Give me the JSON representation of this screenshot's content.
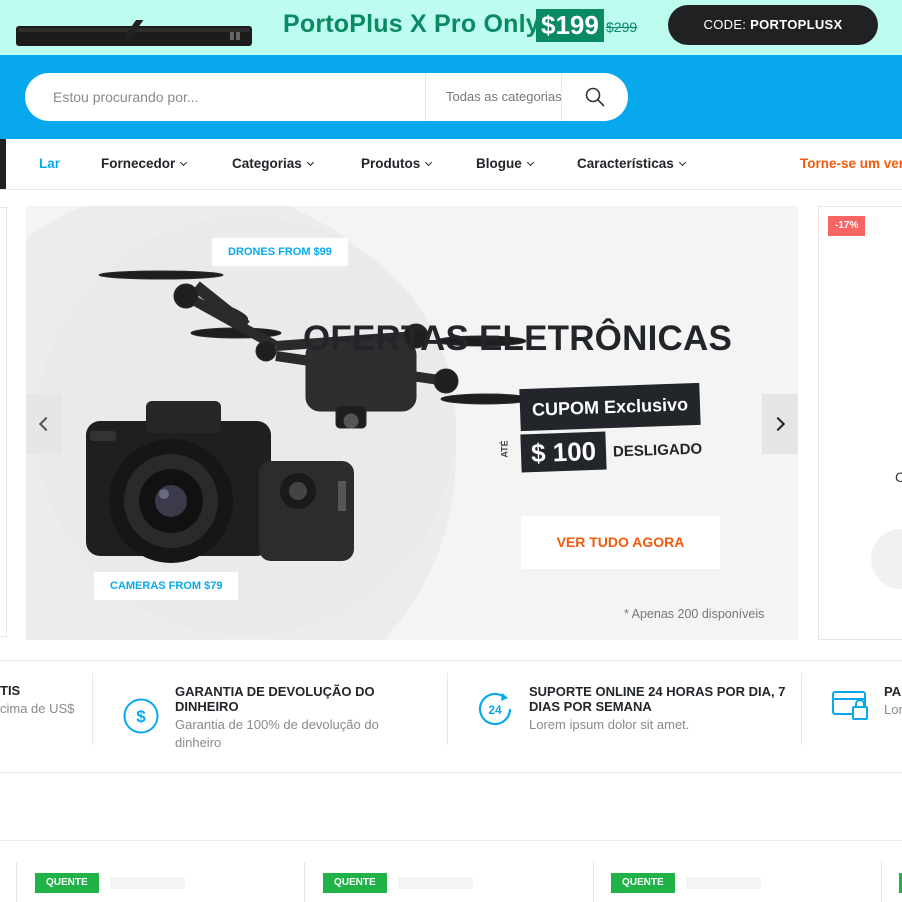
{
  "promo": {
    "headline": "PortoPlus X Pro Only",
    "price": "$199",
    "old_price": "$299",
    "code_prefix": "CODE:",
    "code_value": "PORTOPLUSX"
  },
  "search": {
    "placeholder": "Estou procurando por...",
    "category": "Todas as categorias",
    "icon": "search-icon"
  },
  "nav": {
    "items": [
      {
        "label": "Lar",
        "active": true
      },
      {
        "label": "Fornecedor"
      },
      {
        "label": "Categorias"
      },
      {
        "label": "Produtos"
      },
      {
        "label": "Blogue"
      },
      {
        "label": "Características"
      }
    ],
    "vendor_link": "Torne-se um vendedor"
  },
  "hero": {
    "tag_drones": "DRONES FROM $99",
    "tag_cameras": "CAMERAS FROM $79",
    "title": "OFERTAS ELETRÔNICAS",
    "coupon": "CUPOM Exclusivo",
    "ate": "ATÉ",
    "amount": "$ 100",
    "off": "DESLIGADO",
    "cta": "VER TUDO AGORA",
    "note": "* Apenas 200 disponíveis"
  },
  "side_product": {
    "discount": "-17%",
    "char": "C"
  },
  "features": [
    {
      "title": "TIS",
      "desc": "cima de US$",
      "icon": "truck-icon"
    },
    {
      "title": "GARANTIA DE DEVOLUÇÃO DO DINHEIRO",
      "desc": "Garantia de 100% de devolução do dinheiro",
      "icon": "dollar-icon"
    },
    {
      "title": "SUPORTE ONLINE 24 HORAS POR DIA, 7 DIAS POR SEMANA",
      "desc": "Lorem ipsum dolor sit amet.",
      "icon": "support-24-icon"
    },
    {
      "title": "PA",
      "desc": "Lor",
      "icon": "payment-card-icon"
    }
  ],
  "products": {
    "badge": "QUENTE"
  },
  "colors": {
    "accent": "#08a9ec",
    "promo_bg": "#bdfcef",
    "promo_green": "#0a8a64",
    "orange": "#f2590c",
    "hot_badge": "#1fb347",
    "discount": "#f86565"
  }
}
